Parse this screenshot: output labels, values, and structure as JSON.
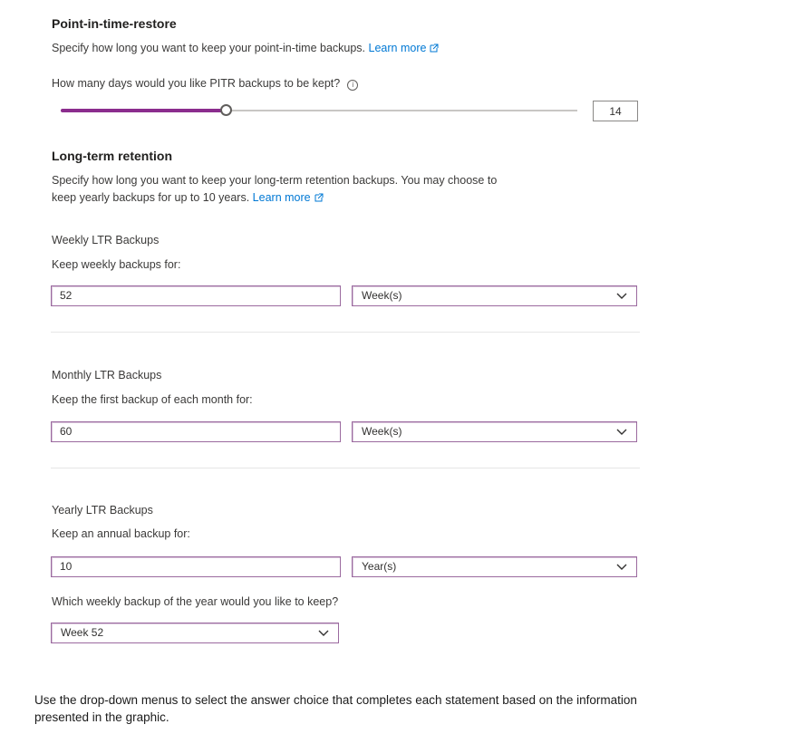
{
  "pitr": {
    "title": "Point-in-time-restore",
    "desc": "Specify how long you want to keep your point-in-time backups.",
    "learn_more": "Learn more",
    "question": "How many days would you like PITR backups to be kept?",
    "value": "14",
    "slider_fraction": 0.32
  },
  "ltr": {
    "title": "Long-term retention",
    "desc_line1": "Specify how long you want to keep your long-term retention backups. You may choose to",
    "desc_line2": "keep yearly backups for up to 10 years.",
    "learn_more": "Learn more",
    "weekly": {
      "heading": "Weekly LTR Backups",
      "label": "Keep weekly backups for:",
      "value": "52",
      "unit": "Week(s)"
    },
    "monthly": {
      "heading": "Monthly LTR Backups",
      "label": "Keep the first backup of each month for:",
      "value": "60",
      "unit": "Week(s)"
    },
    "yearly": {
      "heading": "Yearly LTR Backups",
      "label": "Keep an annual backup for:",
      "value": "10",
      "unit": "Year(s)",
      "week_question": "Which weekly backup of the year would you like to keep?",
      "week_value": "Week 52"
    }
  },
  "footer": {
    "line1": "Use the drop-down menus to select the answer choice that completes each statement based on the information",
    "line2": "presented in the graphic."
  },
  "colors": {
    "accent": "#8b2d8e",
    "link": "#0078d4",
    "input_border": "#9b6a9f"
  }
}
